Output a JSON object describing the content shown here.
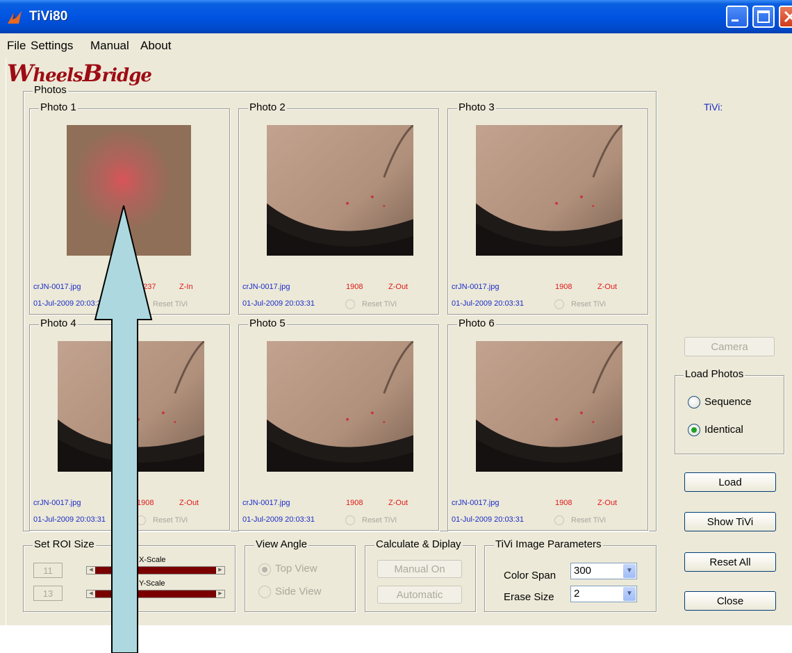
{
  "window": {
    "title": "TiVi80"
  },
  "menu": [
    "File",
    "Settings",
    "Manual",
    "About"
  ],
  "logo": {
    "text": "WheelsBridge"
  },
  "tivi_label": "TiVi:",
  "photos_group": {
    "title": "Photos"
  },
  "photos": [
    {
      "title": "Photo 1",
      "file": "crJN-0017.jpg",
      "value": "9 237",
      "zoom": "Z-In",
      "date": "01-Jul-2009 20:03:31",
      "reset": "Reset TiVi"
    },
    {
      "title": "Photo 2",
      "file": "crJN-0017.jpg",
      "value": "1908",
      "zoom": "Z-Out",
      "date": "01-Jul-2009 20:03:31",
      "reset": "Reset TiVi"
    },
    {
      "title": "Photo 3",
      "file": "crJN-0017.jpg",
      "value": "1908",
      "zoom": "Z-Out",
      "date": "01-Jul-2009 20:03:31",
      "reset": "Reset TiVi"
    },
    {
      "title": "Photo 4",
      "file": "crJN-0017.jpg",
      "value": "1908",
      "zoom": "Z-Out",
      "date": "01-Jul-2009 20:03:31",
      "reset": "Reset TiVi"
    },
    {
      "title": "Photo 5",
      "file": "crJN-0017.jpg",
      "value": "1908",
      "zoom": "Z-Out",
      "date": "01-Jul-2009 20:03:31",
      "reset": "Reset TiVi"
    },
    {
      "title": "Photo 6",
      "file": "crJN-0017.jpg",
      "value": "1908",
      "zoom": "Z-Out",
      "date": "01-Jul-2009 20:03:31",
      "reset": "Reset TiVi"
    }
  ],
  "roi": {
    "title": "Set ROI Size",
    "x_value": "11",
    "y_value": "13",
    "x_label": "X-Scale",
    "y_label": "Y-Scale"
  },
  "view_angle": {
    "title": "View Angle",
    "top": "Top View",
    "side": "Side View"
  },
  "calc": {
    "title": "Calculate & Diplay",
    "manual": "Manual On",
    "automatic": "Automatic"
  },
  "params": {
    "title": "TiVi Image Parameters",
    "color_span_label": "Color Span",
    "color_span": "300",
    "erase_size_label": "Erase Size",
    "erase_size": "2"
  },
  "side": {
    "camera": "Camera",
    "load_photos": "Load Photos",
    "sequence": "Sequence",
    "identical": "Identical",
    "load": "Load",
    "show_tivi": "Show TiVi",
    "reset_all": "Reset All",
    "close": "Close"
  },
  "colors": {
    "title_bar": "#0054e3",
    "logo": "#9d0c14",
    "file_text": "#1a2bc8",
    "value_text": "#e01818",
    "arrow_fill": "#add8e0",
    "slider": "#7a0000"
  }
}
